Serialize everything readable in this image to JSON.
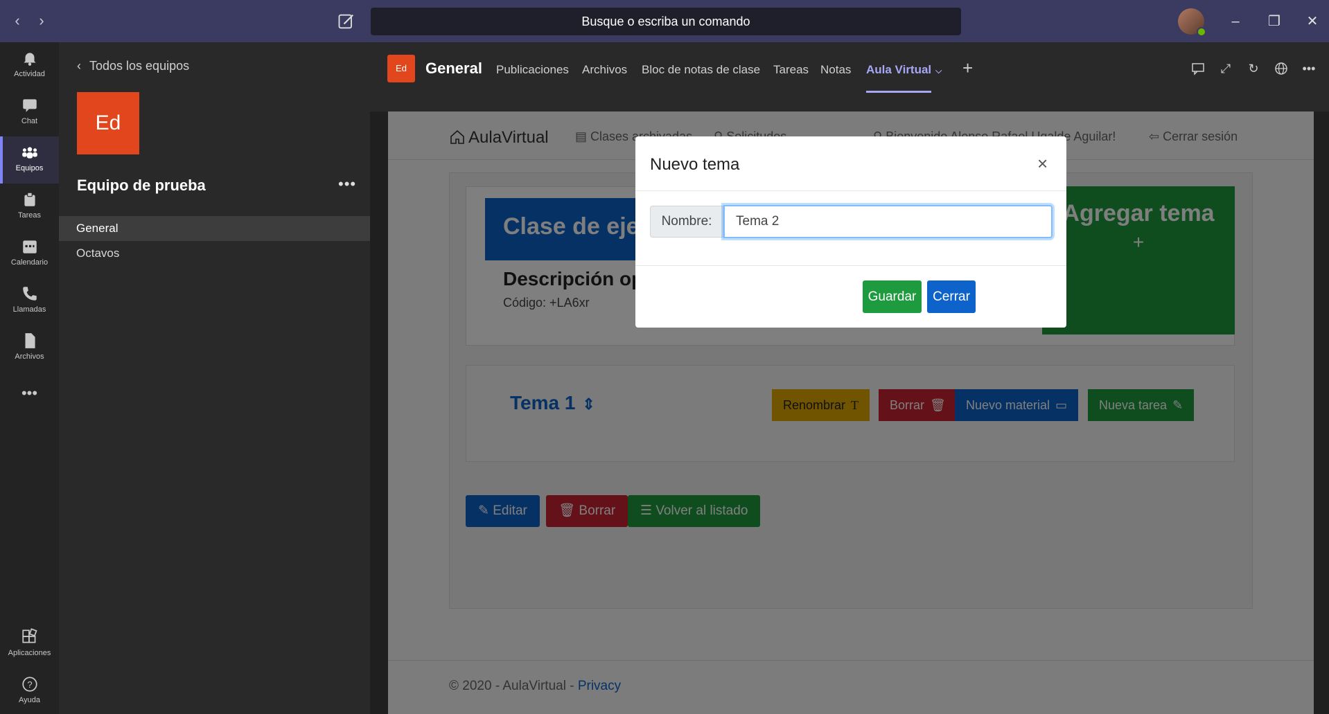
{
  "titlebar": {
    "search_placeholder": "Busque o escriba un comando"
  },
  "rail": {
    "items": [
      {
        "label": "Actividad",
        "icon": "bell-icon"
      },
      {
        "label": "Chat",
        "icon": "chat-icon"
      },
      {
        "label": "Equipos",
        "icon": "teams-icon"
      },
      {
        "label": "Tareas",
        "icon": "assignments-icon"
      },
      {
        "label": "Calendario",
        "icon": "calendar-icon"
      },
      {
        "label": "Llamadas",
        "icon": "phone-icon"
      },
      {
        "label": "Archivos",
        "icon": "files-icon"
      }
    ],
    "more": "•••",
    "apps_label": "Aplicaciones",
    "help_label": "Ayuda"
  },
  "teampanel": {
    "back_label": "Todos los equipos",
    "tile_initials": "Ed",
    "team_name": "Equipo de prueba",
    "more": "•••",
    "channels": [
      "General",
      "Octavos"
    ]
  },
  "channel_header": {
    "tile_initials": "Ed",
    "name": "General",
    "tabs": [
      "Publicaciones",
      "Archivos",
      "Bloc de notas de clase",
      "Tareas",
      "Notas",
      "Aula Virtual"
    ],
    "active_tab": "Aula Virtual"
  },
  "webapp": {
    "brand": "AulaVirtual",
    "nav": {
      "archived": "Clases archivadas",
      "requests": "Solicitudes",
      "welcome": "Bienvenido Alonso Rafael Ugalde Aguilar!",
      "logout": "Cerrar sesión"
    },
    "clase": {
      "title": "Clase de ejemplo",
      "description": "Descripción opcional",
      "code": "Código: +LA6xr"
    },
    "agregar_tema": "Agregar tema",
    "tema": {
      "title": "Tema 1",
      "buttons": {
        "rename": "Renombrar",
        "delete": "Borrar",
        "new_material": "Nuevo material",
        "new_task": "Nueva tarea"
      }
    },
    "footer_buttons": {
      "edit": "Editar",
      "delete": "Borrar",
      "back": "Volver al listado"
    },
    "footer": {
      "copyright": "© 2020 - AulaVirtual - ",
      "privacy": "Privacy"
    }
  },
  "modal": {
    "title": "Nuevo tema",
    "close": "×",
    "label": "Nombre:",
    "value": "Tema 2",
    "save": "Guardar",
    "cancel": "Cerrar"
  },
  "colors": {
    "teams_purple": "#3b3a60",
    "accent": "#7f85f5",
    "primary": "#0d63c9",
    "success": "#1e9b3e",
    "danger": "#c82333",
    "warning": "#e0a800"
  }
}
